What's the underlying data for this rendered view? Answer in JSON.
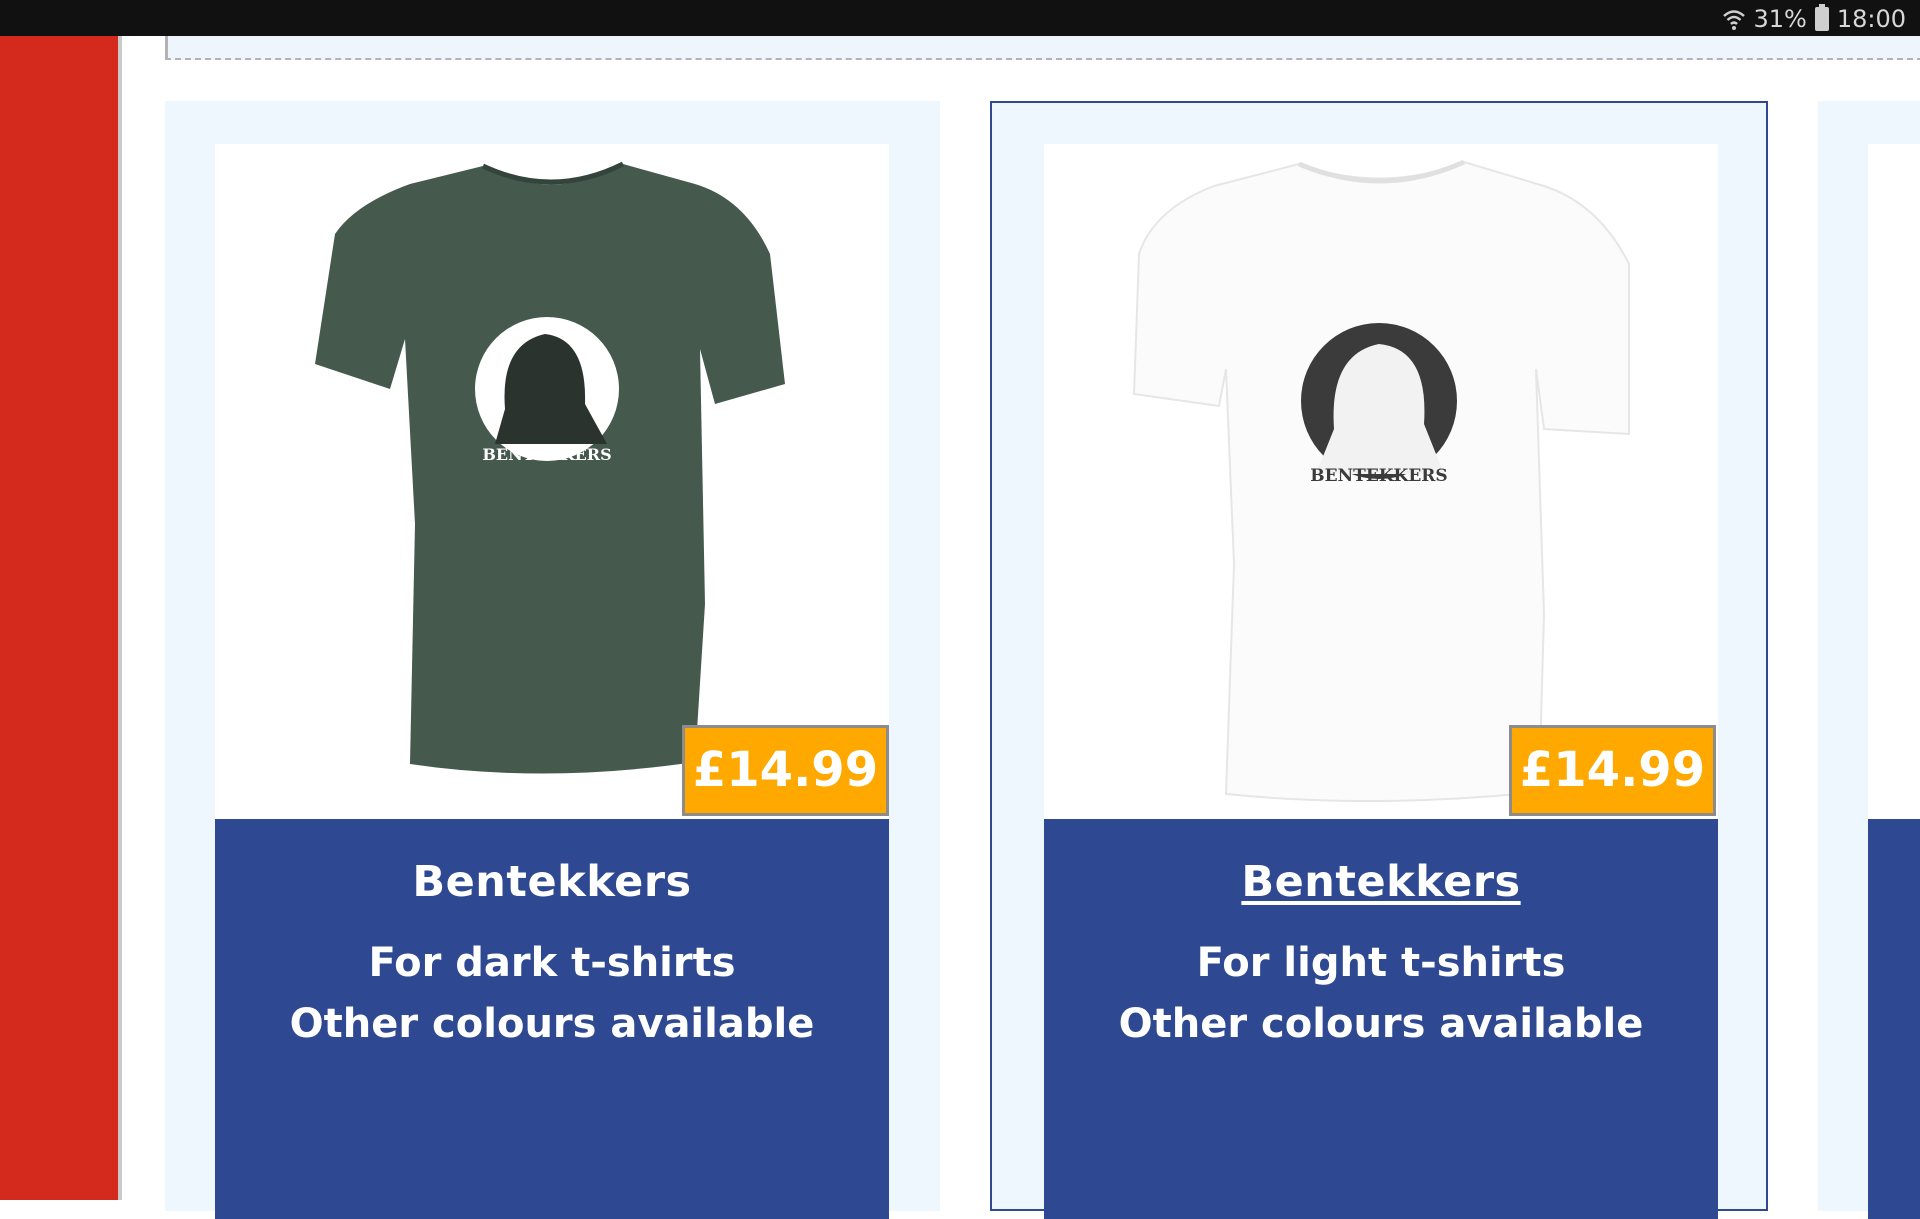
{
  "status_bar": {
    "signal_icon": "wifi-icon",
    "battery_percent": "31%",
    "battery_icon": "battery-icon",
    "time": "18:00"
  },
  "products": [
    {
      "name": "Bentekkers",
      "line1": "For dark t-shirts",
      "line2": "Other colours available",
      "price": "£14.99",
      "shirt_color": "#45594d",
      "print_text": "BENTEKKERS"
    },
    {
      "name": "Bentekkers",
      "line1": "For light t-shirts",
      "line2": "Other colours available",
      "price": "£14.99",
      "shirt_color": "#fafafa",
      "print_text": "BENTEKKERS"
    }
  ],
  "colors": {
    "accent_red": "#d42a1d",
    "panel_blue": "#2e4991",
    "price_orange": "#ffa800",
    "card_bg": "#eef6fe"
  }
}
